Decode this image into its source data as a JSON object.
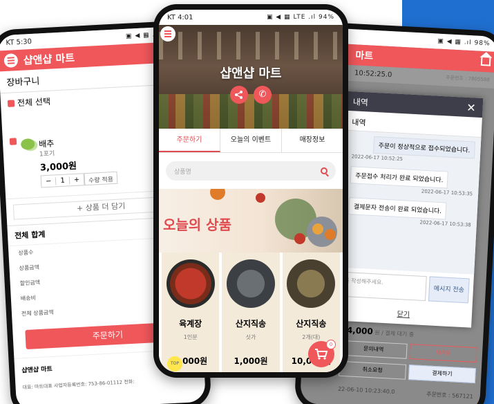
{
  "left": {
    "status": {
      "carrier_time": "KT 5:30",
      "icons": "▣ ◀ ▦ .ıl 98%"
    },
    "header": {
      "title": "샵앤샵 마트"
    },
    "cart_title": "장바구니",
    "select_all": "전체 선택",
    "item": {
      "name": "배추",
      "unit": "1포기",
      "price": "3,000원",
      "qty": "1",
      "minus": "−",
      "plus": "+",
      "apply": "수량 적용"
    },
    "more_button": "+ 상품 더 담기",
    "totals": {
      "title": "전체 합계",
      "rows": [
        "상품수",
        "상품금액",
        "할인금액",
        "배송비",
        "전체 상품금액"
      ]
    },
    "order_button": "주문하기",
    "footer": {
      "shop": "샵앤샵 마트",
      "biz": "대표: 마트대표   사업자등록번호: 753-86-01112   전화:"
    }
  },
  "center": {
    "status": {
      "carrier_time": "KT 4:01",
      "icons": "▣ ◀ ▦ LTE .ıl 94%"
    },
    "hero": {
      "title": "샵앤샵 마트"
    },
    "tabs": [
      "주문하기",
      "오늘의 이벤트",
      "매장정보"
    ],
    "search": {
      "placeholder": "상품명"
    },
    "banner": {
      "title": "오늘의 상품"
    },
    "products": [
      {
        "name": "육계장",
        "option": "1인분",
        "price": "7,000원"
      },
      {
        "name": "산지직송",
        "option": "싯가",
        "price": "1,000원"
      },
      {
        "name": "산지직송",
        "option": "2개(대)",
        "price": "10,000원"
      }
    ],
    "top_label": "TOP",
    "cart_count": "0"
  },
  "right": {
    "status": {
      "icons": "▣ ◀ ▦ .ıl 98%"
    },
    "header": {
      "title": "마트"
    },
    "order_row": {
      "time": "10:52:25.0",
      "order_no": "주문번호 : 7805588"
    },
    "modal": {
      "title": "내역",
      "subtitle": "내역",
      "messages": [
        {
          "text": "주문이 정상적으로 접수되었습니다.",
          "time": "2022-06-17 10:52:25"
        },
        {
          "text": "주문접수 처리가 완료 되었습니다.",
          "time": "2022-06-17 10:53:35"
        },
        {
          "text": "결제문자 전송이 완료 되었습니다.",
          "time": "2022-06-17 10:53:38"
        }
      ],
      "input_placeholder": "를 작성해주세요.",
      "send_button": "메시지 전송",
      "close_link": "닫기"
    },
    "price_line": {
      "amount": "14,000",
      "suffix": " 원 / 결제 대기 중"
    },
    "buttons": [
      "문의내역",
      "재주문",
      "취소요청",
      "결제하기"
    ],
    "last_row": {
      "date": "22-06-10 10:23:40.0",
      "order_no": "주문번호 : 567121"
    }
  }
}
